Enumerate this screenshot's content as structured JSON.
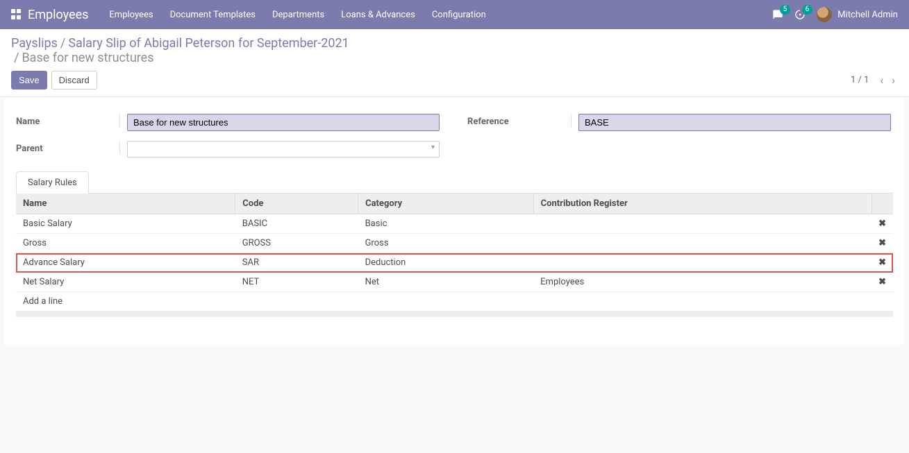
{
  "navbar": {
    "brand": "Employees",
    "menu": [
      "Employees",
      "Document Templates",
      "Departments",
      "Loans & Advances",
      "Configuration"
    ],
    "messages_count": "5",
    "activities_count": "6",
    "user_name": "Mitchell Admin"
  },
  "breadcrumb": {
    "items": [
      "Payslips",
      "Salary Slip of Abigail Peterson for September-2021"
    ],
    "current": "Base for new structures"
  },
  "actions": {
    "save_label": "Save",
    "discard_label": "Discard",
    "pager_text": "1 / 1"
  },
  "form": {
    "name_label": "Name",
    "name_value": "Base for new structures",
    "parent_label": "Parent",
    "parent_value": "",
    "reference_label": "Reference",
    "reference_value": "BASE"
  },
  "tabs": {
    "salary_rules": "Salary Rules"
  },
  "table": {
    "headers": {
      "name": "Name",
      "code": "Code",
      "category": "Category",
      "contribution": "Contribution Register"
    },
    "rows": [
      {
        "name": "Basic Salary",
        "code": "BASIC",
        "category": "Basic",
        "contribution": "",
        "highlighted": false
      },
      {
        "name": "Gross",
        "code": "GROSS",
        "category": "Gross",
        "contribution": "",
        "highlighted": false
      },
      {
        "name": "Advance Salary",
        "code": "SAR",
        "category": "Deduction",
        "contribution": "",
        "highlighted": true
      },
      {
        "name": "Net Salary",
        "code": "NET",
        "category": "Net",
        "contribution": "Employees",
        "highlighted": false
      }
    ],
    "add_line": "Add a line",
    "delete_glyph": "✖"
  }
}
